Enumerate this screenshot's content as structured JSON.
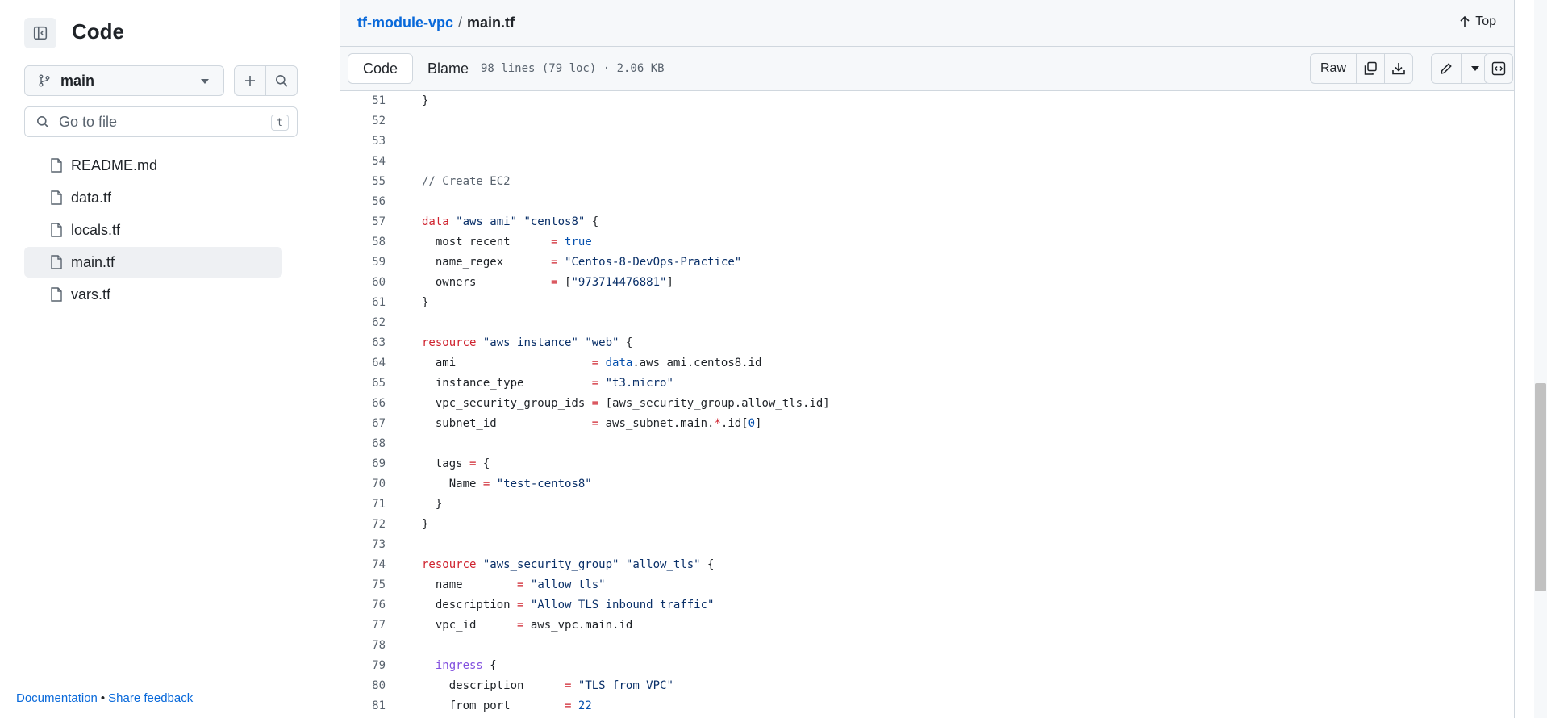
{
  "sidebar": {
    "title": "Code",
    "branch": "main",
    "goto_placeholder": "Go to file",
    "goto_shortcut": "t",
    "files": [
      {
        "label": "README.md",
        "active": false
      },
      {
        "label": "data.tf",
        "active": false
      },
      {
        "label": "locals.tf",
        "active": false
      },
      {
        "label": "main.tf",
        "active": true
      },
      {
        "label": "vars.tf",
        "active": false
      }
    ],
    "footer": {
      "documentation": "Documentation",
      "separator": "•",
      "feedback": "Share feedback"
    }
  },
  "header": {
    "repo": "tf-module-vpc",
    "separator": "/",
    "file": "main.tf",
    "top_label": "Top"
  },
  "toolbar": {
    "code_tab": "Code",
    "blame_tab": "Blame",
    "meta": "98 lines (79 loc) · 2.06 KB",
    "raw_label": "Raw"
  },
  "colors": {
    "link": "#0969da",
    "keyword": "#cf222e",
    "string": "#0a3069",
    "comment": "#59636e",
    "builtin": "#0550ae",
    "property": "#8250df"
  },
  "code": [
    {
      "n": "51",
      "t": [
        [
          "}",
          ""
        ]
      ]
    },
    {
      "n": "52",
      "t": []
    },
    {
      "n": "53",
      "t": []
    },
    {
      "n": "54",
      "t": []
    },
    {
      "n": "55",
      "t": [
        [
          "// Create EC2",
          "c"
        ]
      ]
    },
    {
      "n": "56",
      "t": []
    },
    {
      "n": "57",
      "t": [
        [
          "data",
          "k"
        ],
        [
          " ",
          ""
        ],
        [
          "\"aws_ami\"",
          "s"
        ],
        [
          " ",
          ""
        ],
        [
          "\"centos8\"",
          "s"
        ],
        [
          " {",
          ""
        ]
      ]
    },
    {
      "n": "58",
      "t": [
        [
          "  most_recent      ",
          ""
        ],
        [
          "=",
          "k"
        ],
        [
          " ",
          ""
        ],
        [
          "true",
          "b"
        ]
      ]
    },
    {
      "n": "59",
      "t": [
        [
          "  name_regex       ",
          ""
        ],
        [
          "=",
          "k"
        ],
        [
          " ",
          ""
        ],
        [
          "\"Centos-8-DevOps-Practice\"",
          "s"
        ]
      ]
    },
    {
      "n": "60",
      "t": [
        [
          "  owners           ",
          ""
        ],
        [
          "=",
          "k"
        ],
        [
          " [",
          ""
        ],
        [
          "\"973714476881\"",
          "s"
        ],
        [
          "]",
          ""
        ]
      ]
    },
    {
      "n": "61",
      "t": [
        [
          "}",
          ""
        ]
      ]
    },
    {
      "n": "62",
      "t": []
    },
    {
      "n": "63",
      "t": [
        [
          "resource",
          "k"
        ],
        [
          " ",
          ""
        ],
        [
          "\"aws_instance\"",
          "s"
        ],
        [
          " ",
          ""
        ],
        [
          "\"web\"",
          "s"
        ],
        [
          " {",
          ""
        ]
      ]
    },
    {
      "n": "64",
      "t": [
        [
          "  ami                    ",
          ""
        ],
        [
          "=",
          "k"
        ],
        [
          " ",
          ""
        ],
        [
          "data",
          "b"
        ],
        [
          ".aws_ami.centos8.id",
          ""
        ]
      ]
    },
    {
      "n": "65",
      "t": [
        [
          "  instance_type          ",
          ""
        ],
        [
          "=",
          "k"
        ],
        [
          " ",
          ""
        ],
        [
          "\"t3.micro\"",
          "s"
        ]
      ]
    },
    {
      "n": "66",
      "t": [
        [
          "  vpc_security_group_ids ",
          ""
        ],
        [
          "=",
          "k"
        ],
        [
          " [aws_security_group.allow_tls.id]",
          ""
        ]
      ]
    },
    {
      "n": "67",
      "t": [
        [
          "  subnet_id              ",
          ""
        ],
        [
          "=",
          "k"
        ],
        [
          " aws_subnet.main.",
          ""
        ],
        [
          "*",
          "k"
        ],
        [
          ".id[",
          ""
        ],
        [
          "0",
          "b"
        ],
        [
          "]",
          ""
        ]
      ]
    },
    {
      "n": "68",
      "t": []
    },
    {
      "n": "69",
      "t": [
        [
          "  tags ",
          ""
        ],
        [
          "=",
          "k"
        ],
        [
          " {",
          ""
        ]
      ]
    },
    {
      "n": "70",
      "t": [
        [
          "    Name ",
          ""
        ],
        [
          "=",
          "k"
        ],
        [
          " ",
          ""
        ],
        [
          "\"test-centos8\"",
          "s"
        ]
      ]
    },
    {
      "n": "71",
      "t": [
        [
          "  }",
          ""
        ]
      ]
    },
    {
      "n": "72",
      "t": [
        [
          "}",
          ""
        ]
      ]
    },
    {
      "n": "73",
      "t": []
    },
    {
      "n": "74",
      "t": [
        [
          "resource",
          "k"
        ],
        [
          " ",
          ""
        ],
        [
          "\"aws_security_group\"",
          "s"
        ],
        [
          " ",
          ""
        ],
        [
          "\"allow_tls\"",
          "s"
        ],
        [
          " {",
          ""
        ]
      ]
    },
    {
      "n": "75",
      "t": [
        [
          "  name        ",
          ""
        ],
        [
          "=",
          "k"
        ],
        [
          " ",
          ""
        ],
        [
          "\"allow_tls\"",
          "s"
        ]
      ]
    },
    {
      "n": "76",
      "t": [
        [
          "  description ",
          ""
        ],
        [
          "=",
          "k"
        ],
        [
          " ",
          ""
        ],
        [
          "\"Allow TLS inbound traffic\"",
          "s"
        ]
      ]
    },
    {
      "n": "77",
      "t": [
        [
          "  vpc_id      ",
          ""
        ],
        [
          "=",
          "k"
        ],
        [
          " aws_vpc.main.id",
          ""
        ]
      ]
    },
    {
      "n": "78",
      "t": []
    },
    {
      "n": "79",
      "t": [
        [
          "  ",
          ""
        ],
        [
          "ingress",
          "p"
        ],
        [
          " {",
          ""
        ]
      ]
    },
    {
      "n": "80",
      "t": [
        [
          "    description      ",
          ""
        ],
        [
          "=",
          "k"
        ],
        [
          " ",
          ""
        ],
        [
          "\"TLS from VPC\"",
          "s"
        ]
      ]
    },
    {
      "n": "81",
      "t": [
        [
          "    from_port        ",
          ""
        ],
        [
          "=",
          "k"
        ],
        [
          " ",
          ""
        ],
        [
          "22",
          "b"
        ]
      ]
    }
  ]
}
